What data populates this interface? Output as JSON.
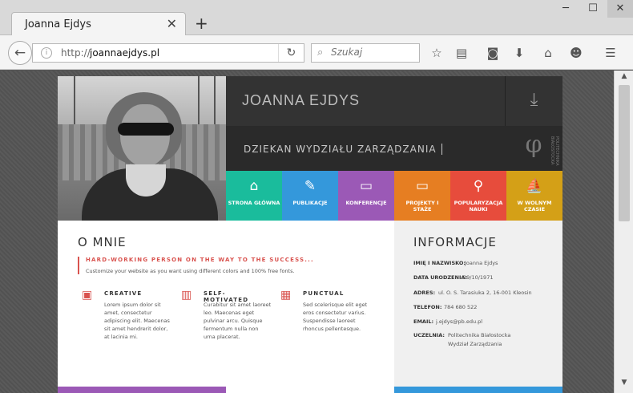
{
  "browser": {
    "tab_title": "Joanna Ejdys",
    "url_scheme": "http://",
    "url_host": "joannaejdys.pl",
    "search_placeholder": "Szukaj"
  },
  "site": {
    "name": "JOANNA EJDYS",
    "subtitle": "DZIEKAN WYDZIAŁU ZARZĄDZANIA",
    "logo_text": "POLITECHNIKA BIAŁOSTOCKA",
    "menu": [
      {
        "label": "STRONA GŁÓWNA",
        "icon": "home-icon",
        "color": "#1abc9c"
      },
      {
        "label": "PUBLIKACJE",
        "icon": "edit-icon",
        "color": "#3498db"
      },
      {
        "label": "KONFERENCJE",
        "icon": "presentation-icon",
        "color": "#9b59b6"
      },
      {
        "label": "PROJEKTY I STAŻE",
        "icon": "laptop-icon",
        "color": "#e67e22"
      },
      {
        "label": "POPULARYZACJA NAUKI",
        "icon": "rocket-icon",
        "color": "#e74c3c"
      },
      {
        "label": "W WOLNYM CZASIE",
        "icon": "sailboat-icon",
        "color": "#d4a017"
      }
    ],
    "about": {
      "heading": "O MNIE",
      "quote_title": "HARD-WORKING PERSON ON THE WAY TO THE SUCCESS...",
      "quote_text": "Customize your website as you want using different colors and 100% free fonts.",
      "features": [
        {
          "icon": "image-icon",
          "title": "CREATIVE",
          "text": "Lorem ipsum dolor sit amet, consectetur adipiscing elit. Maecenas sit amet hendrerit dolor, at lacinia mi."
        },
        {
          "icon": "chart-icon",
          "title": "SELF-MOTIVATED",
          "text": "Curabitur sit amet laoreet leo. Maecenas eget pulvinar arcu. Quisque fermentum nulla non urna placerat."
        },
        {
          "icon": "calculator-icon",
          "title": "PUNCTUAL",
          "text": "Sed scelerisque elit eget eros consectetur varius. Suspendisse laoreet rhoncus pellentesque."
        }
      ]
    },
    "info": {
      "heading": "INFORMACJE",
      "rows": [
        {
          "key": "IMIĘ I NAZWISKO:",
          "value": "Joanna Ejdys"
        },
        {
          "key": "DATA URODZENIA:",
          "value": "29/10/1971"
        },
        {
          "key": "ADRES:",
          "value": "ul. O. S. Tarasiuka 2, 16-001 Kleosin"
        },
        {
          "key": "TELEFON:",
          "value": "784 680 522"
        },
        {
          "key": "EMAIL:",
          "value": "j.ejdys@pb.edu.pl"
        },
        {
          "key": "UCZELNIA:",
          "value": "Politechnika Białostocka",
          "value2": "Wydział Zarządzania"
        }
      ]
    }
  }
}
